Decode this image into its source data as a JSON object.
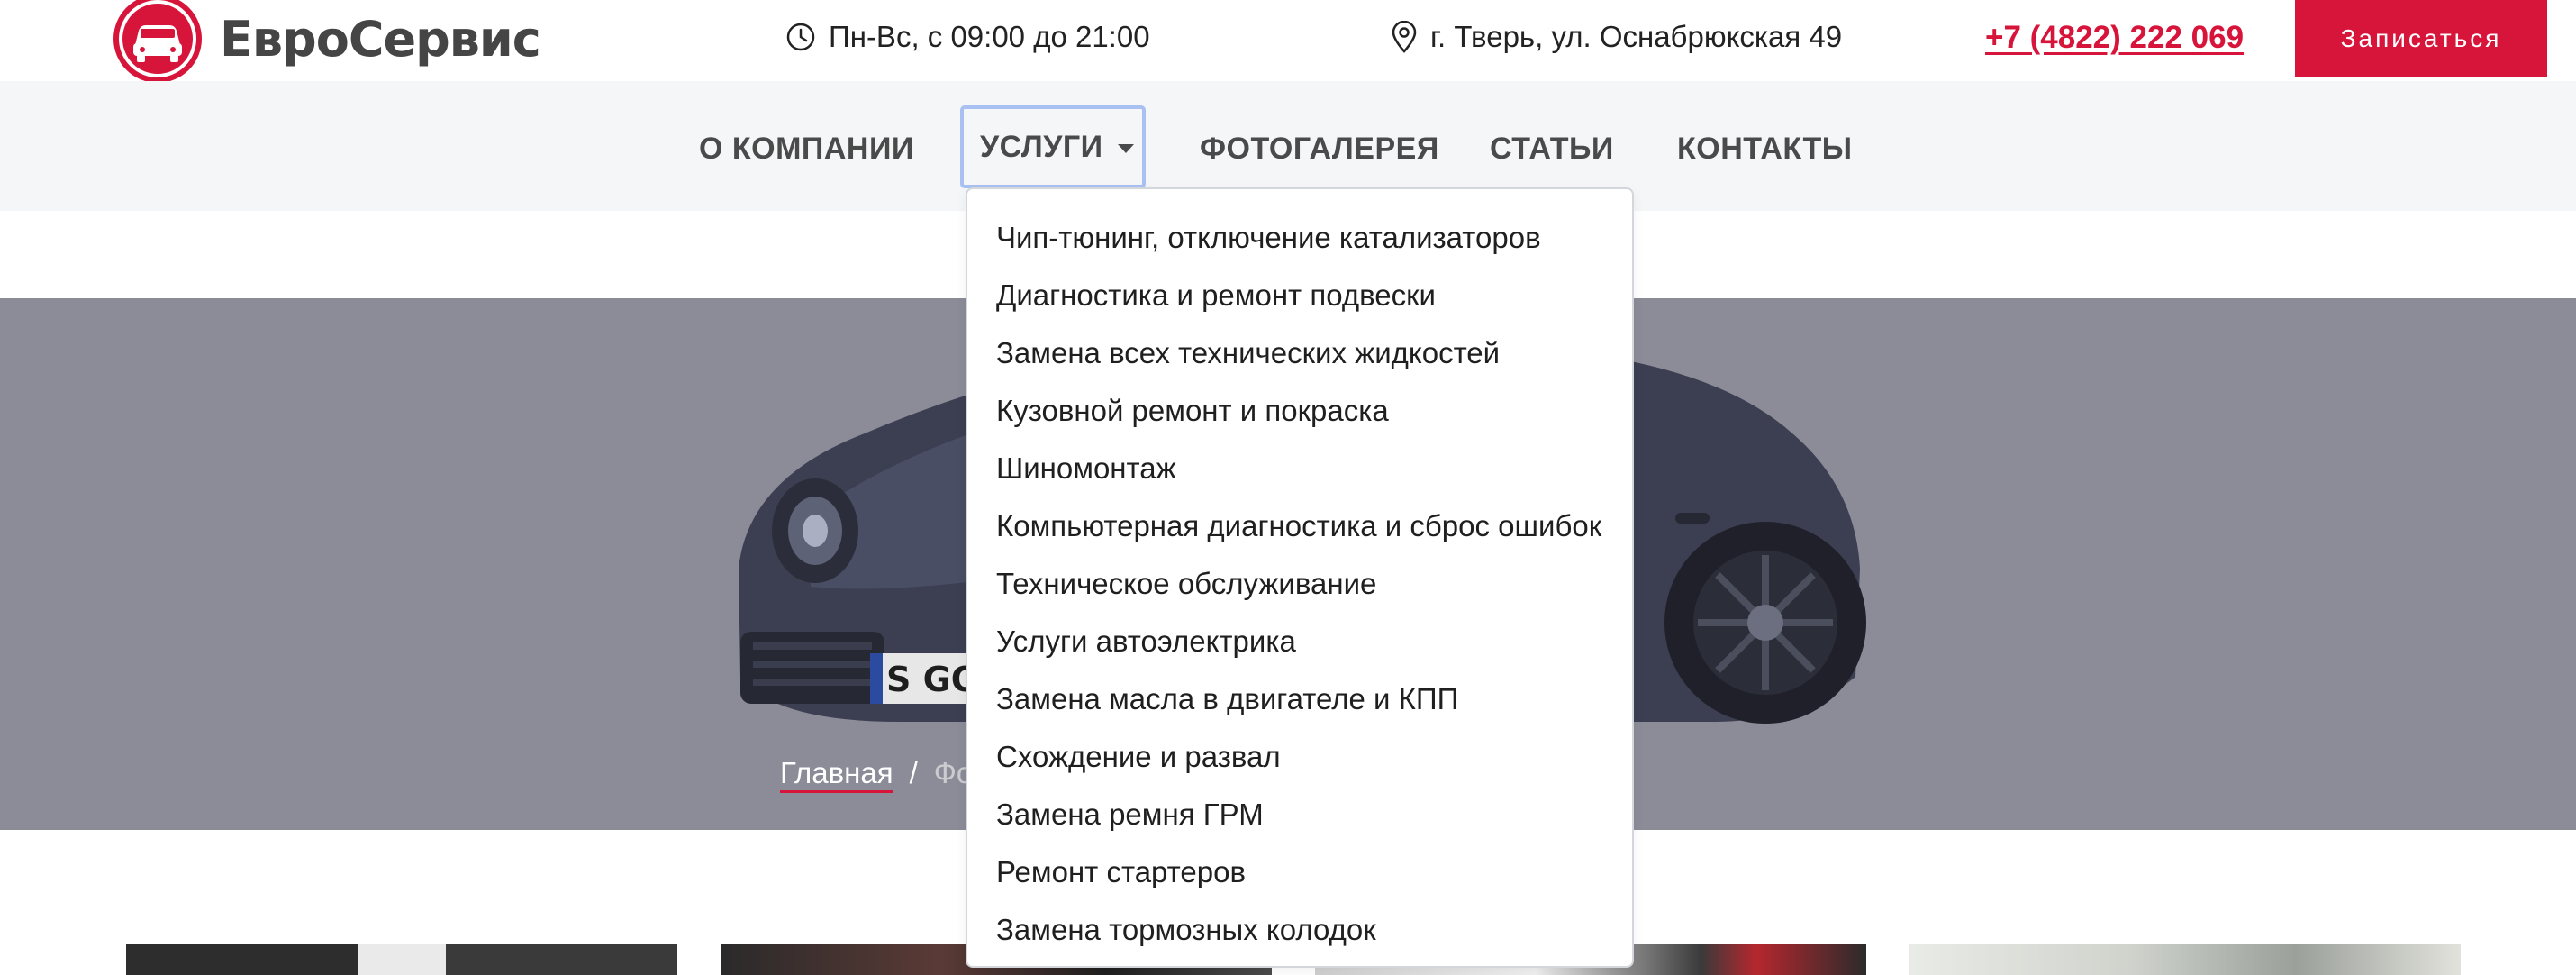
{
  "header": {
    "brand": "ЕвроСервис",
    "hours": "Пн-Вс, с 09:00 до 21:00",
    "address": "г. Тверь, ул. Оснабрюкская 49",
    "phone": "+7 (4822) 222 069",
    "cta_label": "Записаться",
    "icons": {
      "logo": "car-logo-icon",
      "hours": "clock-icon",
      "address": "map-pin-icon"
    }
  },
  "nav": {
    "items": [
      {
        "label": "О КОМПАНИИ"
      },
      {
        "label": "УСЛУГИ",
        "has_dropdown": true,
        "expanded": true
      },
      {
        "label": "ФОТОГАЛЕРЕЯ"
      },
      {
        "label": "СТАТЬИ"
      },
      {
        "label": "КОНТАКТЫ"
      }
    ]
  },
  "services_dropdown": {
    "items": [
      "Чип-тюнинг, отключение катализаторов",
      "Диагностика и ремонт подвески",
      "Замена всех технических жидкостей",
      "Кузовной ремонт и покраска",
      "Шиномонтаж",
      "Компьютерная диагностика и сброс ошибок",
      "Техническое обслуживание",
      "Услуги автоэлектрика",
      "Замена масла в двигателе и КПП",
      "Схождение и развал",
      "Замена ремня ГРМ",
      "Ремонт стартеров",
      "Замена тормозных колодок"
    ]
  },
  "breadcrumb": {
    "home": "Главная",
    "separator": "/",
    "current": "Фо"
  },
  "colors": {
    "accent": "#d7153a",
    "nav_bg": "#f5f6f8",
    "hero_bg": "#8c8c98",
    "focus_ring": "#a9c1f2"
  }
}
